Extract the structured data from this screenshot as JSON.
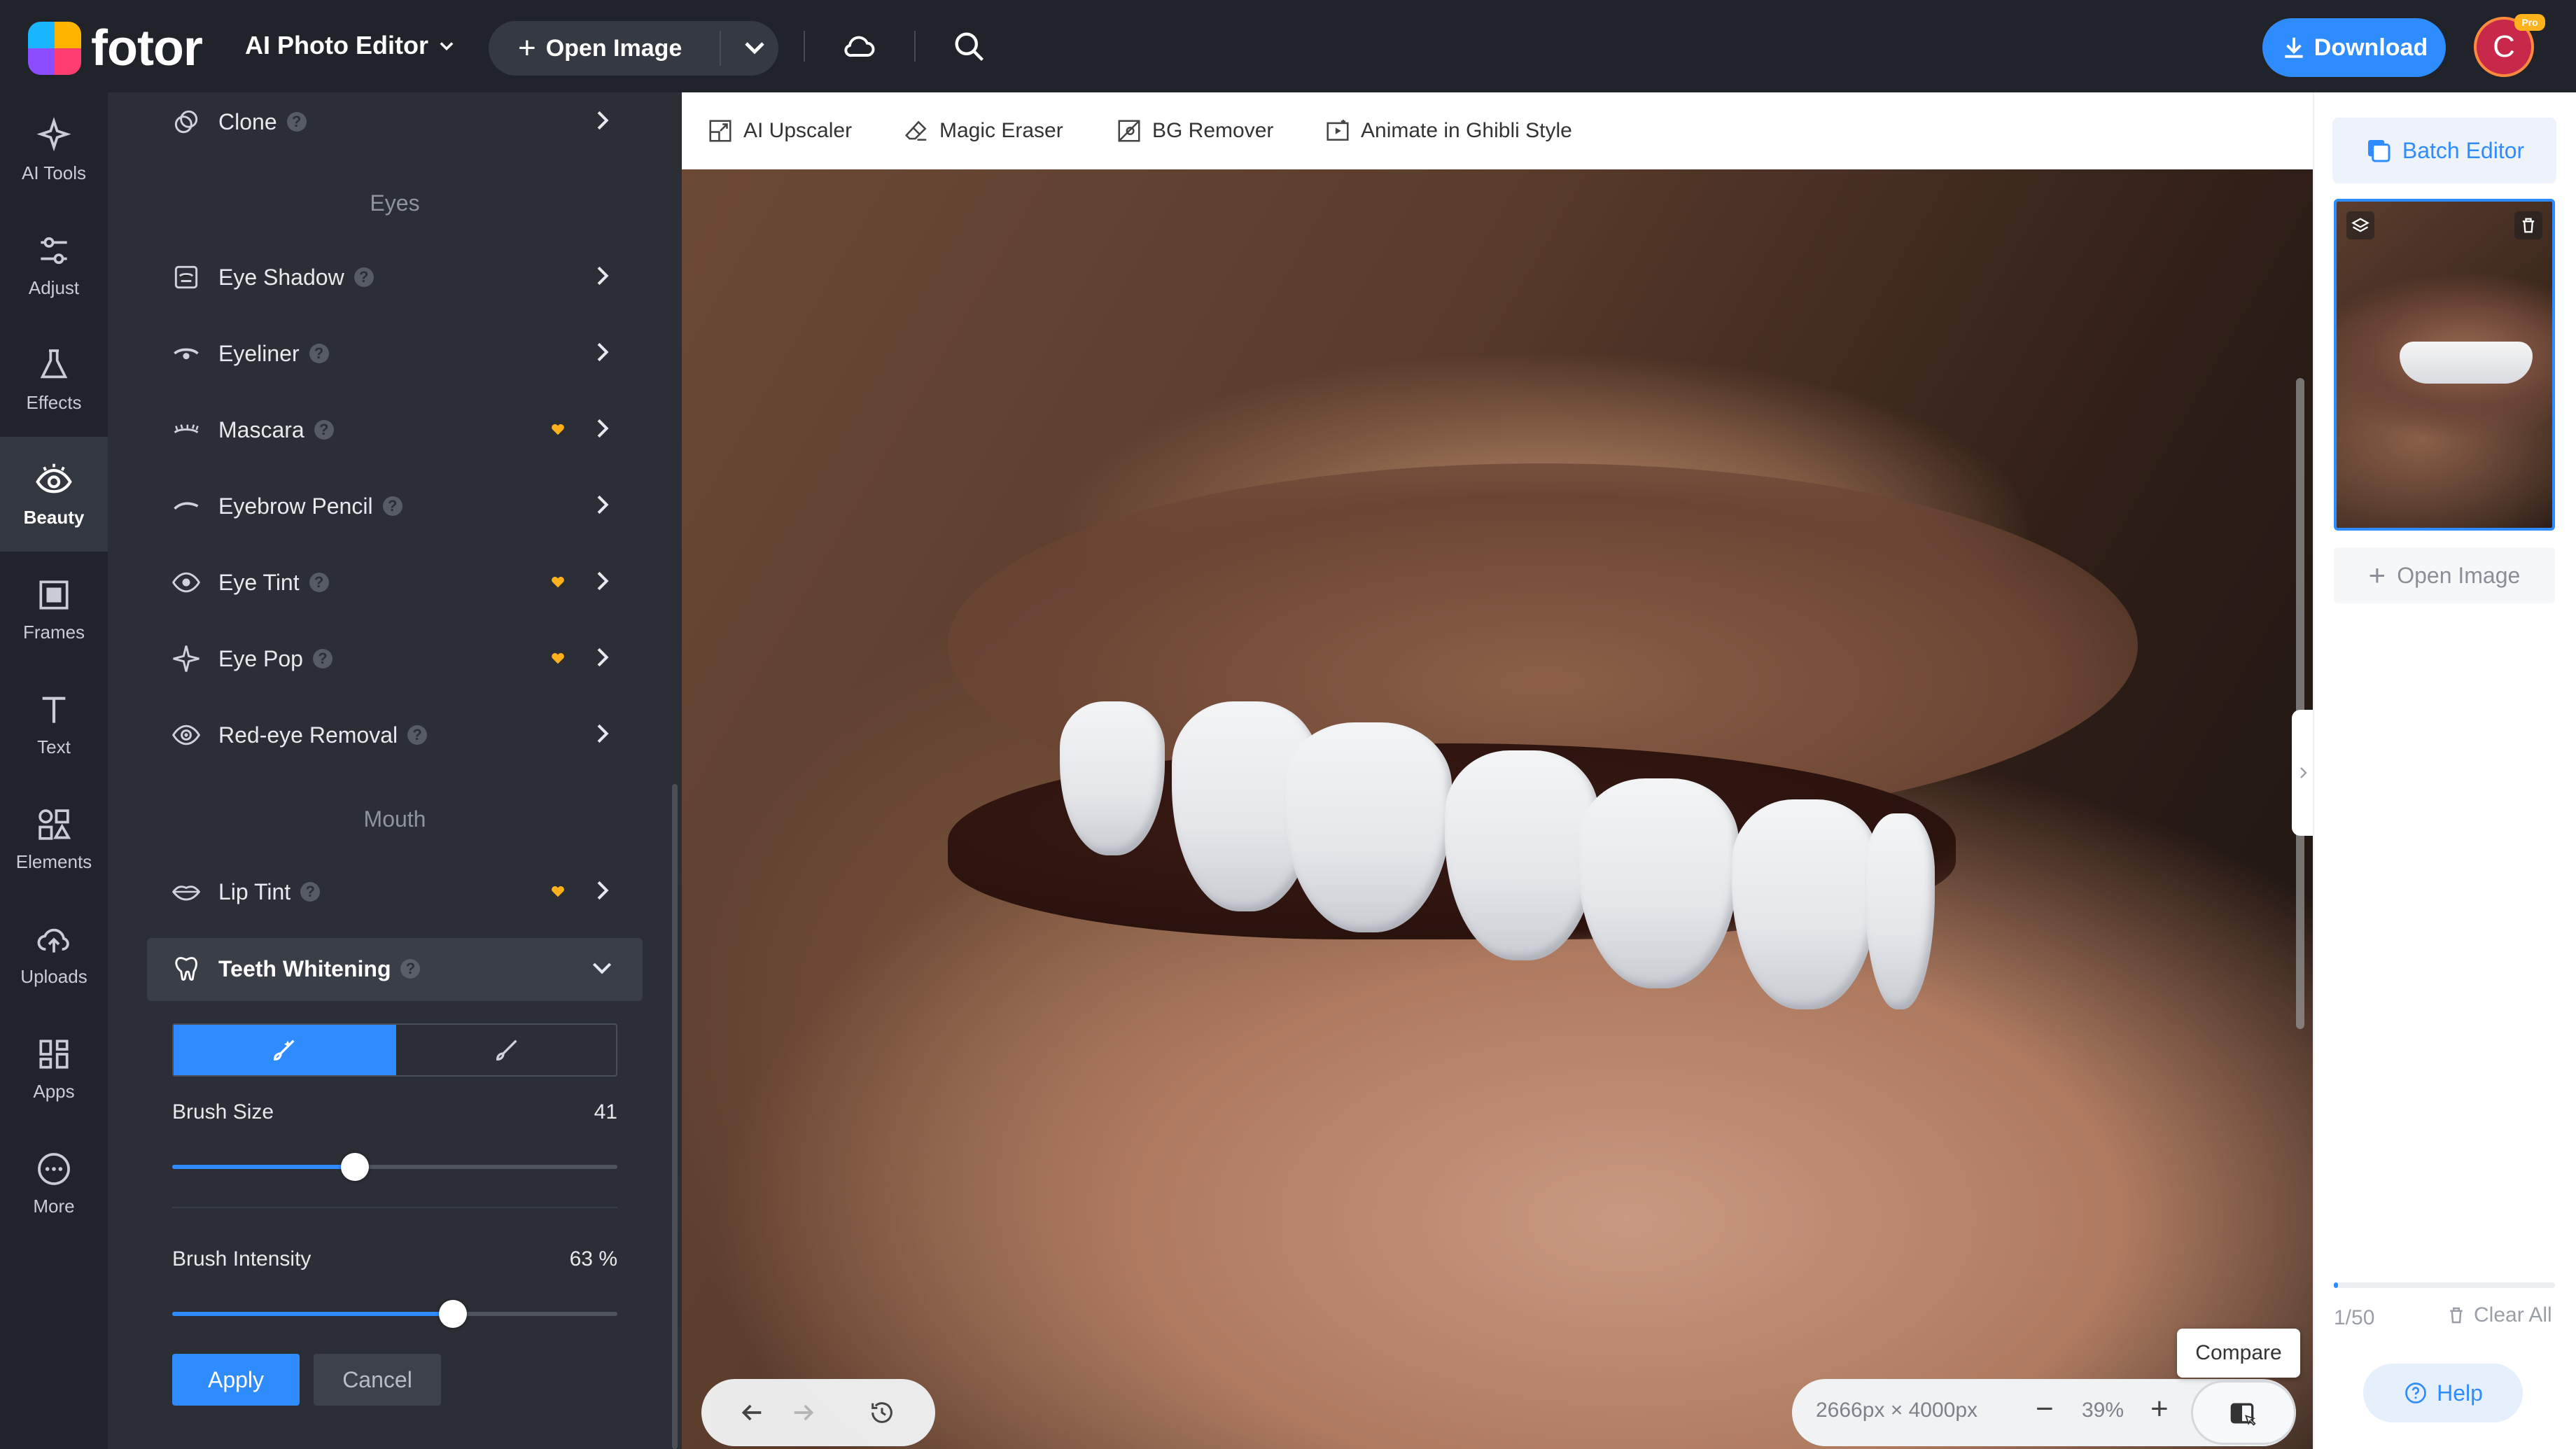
{
  "app": {
    "logo_text": "fotor",
    "title": "AI Photo Editor"
  },
  "header": {
    "open_image": "Open Image",
    "download": "Download",
    "avatar_initial": "C",
    "pro_badge": "Pro"
  },
  "rail": [
    {
      "label": "AI Tools",
      "icon": "sparkle-icon"
    },
    {
      "label": "Adjust",
      "icon": "sliders-icon"
    },
    {
      "label": "Effects",
      "icon": "flask-icon"
    },
    {
      "label": "Beauty",
      "icon": "eye-icon",
      "active": true
    },
    {
      "label": "Frames",
      "icon": "frame-icon"
    },
    {
      "label": "Text",
      "icon": "text-icon"
    },
    {
      "label": "Elements",
      "icon": "shapes-icon"
    },
    {
      "label": "Uploads",
      "icon": "cloud-upload-icon"
    },
    {
      "label": "Apps",
      "icon": "apps-icon"
    },
    {
      "label": "More",
      "icon": "more-icon"
    }
  ],
  "panel": {
    "clone": "Clone",
    "sections": {
      "eyes": "Eyes",
      "mouth": "Mouth"
    },
    "eye_items": [
      {
        "label": "Eye Shadow",
        "premium": false
      },
      {
        "label": "Eyeliner",
        "premium": false
      },
      {
        "label": "Mascara",
        "premium": true
      },
      {
        "label": "Eyebrow Pencil",
        "premium": false
      },
      {
        "label": "Eye Tint",
        "premium": true
      },
      {
        "label": "Eye Pop",
        "premium": true
      },
      {
        "label": "Red-eye Removal",
        "premium": false
      }
    ],
    "lip_tint": "Lip Tint",
    "teeth_whitening": "Teeth Whitening",
    "brush_size_label": "Brush Size",
    "brush_size_value": "41",
    "brush_size_fraction": 0.41,
    "brush_intensity_label": "Brush Intensity",
    "brush_intensity_value": "63 %",
    "brush_intensity_fraction": 0.63,
    "apply": "Apply",
    "cancel": "Cancel",
    "help_mark": "?"
  },
  "tools": [
    {
      "label": "AI Upscaler",
      "icon": "upscale-icon"
    },
    {
      "label": "Magic Eraser",
      "icon": "eraser-icon"
    },
    {
      "label": "BG Remover",
      "icon": "bg-remover-icon"
    },
    {
      "label": "Animate in Ghibli Style",
      "icon": "animate-icon"
    }
  ],
  "canvas": {
    "dimensions": "2666px × 4000px",
    "zoom": "39%",
    "compare_tooltip": "Compare"
  },
  "right": {
    "batch_editor": "Batch Editor",
    "open_image": "Open Image",
    "count": "1/50",
    "clear_all": "Clear All",
    "help": "Help",
    "progress_fraction": 0.02
  },
  "colors": {
    "accent": "#2f8cff",
    "dark_bg": "#20232a",
    "panel_bg": "#2b2e35",
    "premium": "#ffb21b"
  }
}
